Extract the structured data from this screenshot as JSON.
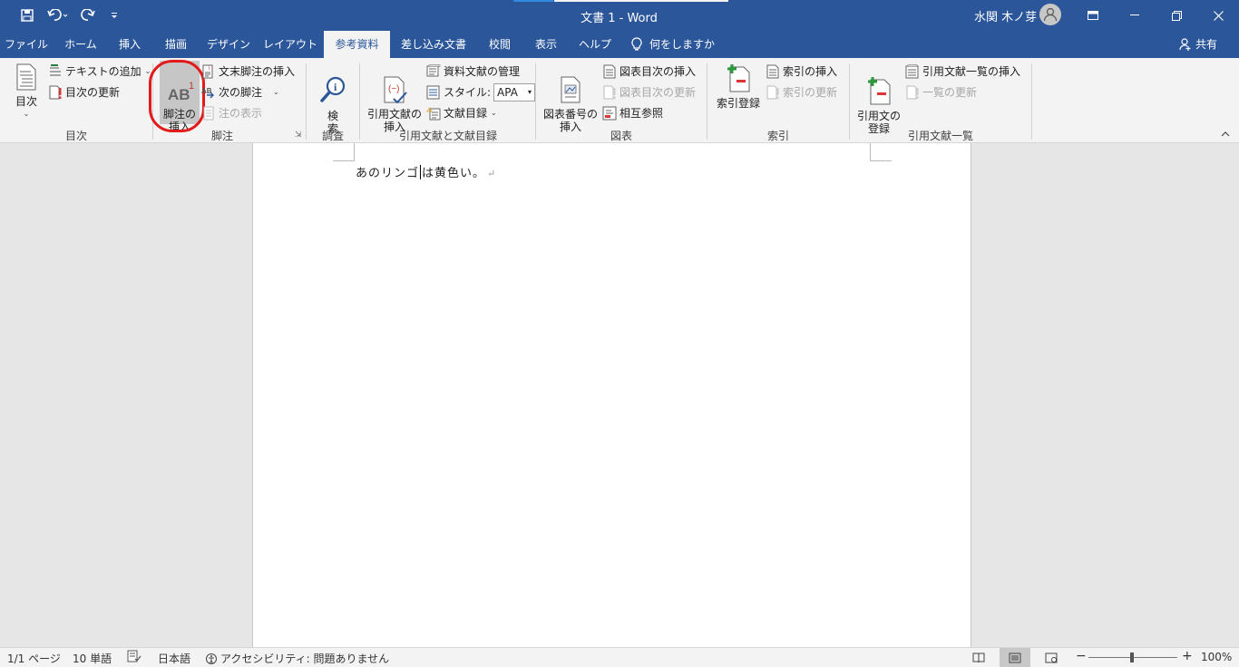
{
  "window": {
    "title": "文書 1  -  Word",
    "user_name": "水関 木ノ芽"
  },
  "quick_access": {
    "save_icon": "save-icon",
    "undo_icon": "undo-icon",
    "redo_icon": "redo-icon",
    "customize_icon": "customize-icon"
  },
  "tabs": [
    {
      "label": "ファイル"
    },
    {
      "label": "ホーム"
    },
    {
      "label": "挿入"
    },
    {
      "label": "描画"
    },
    {
      "label": "デザイン"
    },
    {
      "label": "レイアウト"
    },
    {
      "label": "参考資料"
    },
    {
      "label": "差し込み文書"
    },
    {
      "label": "校閲"
    },
    {
      "label": "表示"
    },
    {
      "label": "ヘルプ"
    },
    {
      "label": "何をしますか"
    }
  ],
  "share_label": "共有",
  "ribbon": {
    "toc": {
      "group": "目次",
      "toc_button": "目次",
      "add_text": "テキストの追加",
      "update_toc": "目次の更新"
    },
    "footnotes": {
      "group": "脚注",
      "insert_footnote": "脚注の\n挿入",
      "insert_endnote": "文末脚注の挿入",
      "next_footnote": "次の脚注",
      "show_notes": "注の表示"
    },
    "research": {
      "group": "調査",
      "search": "検\n索"
    },
    "citations": {
      "group": "引用文献と文献目録",
      "insert_citation": "引用文献の\n挿入",
      "manage_sources": "資料文献の管理",
      "style_label": "スタイル:",
      "style_value": "APA",
      "bibliography": "文献目録"
    },
    "captions": {
      "group": "図表",
      "insert_caption": "図表番号の\n挿入",
      "insert_table_of_figures": "図表目次の挿入",
      "update_table": "図表目次の更新",
      "cross_reference": "相互参照"
    },
    "index": {
      "group": "索引",
      "mark_entry": "索引登録",
      "insert_index": "索引の挿入",
      "update_index": "索引の更新"
    },
    "authorities": {
      "group": "引用文献一覧",
      "mark_citation": "引用文の\n登録",
      "insert_table": "引用文献一覧の挿入",
      "update_table": "一覧の更新"
    }
  },
  "document": {
    "text_before_cursor": "あのリンゴ",
    "text_after_cursor": "は黄色い。",
    "paragraph_mark": "↵"
  },
  "status": {
    "page": "1/1 ページ",
    "words": "10 単語",
    "language": "日本語",
    "accessibility": "アクセシビリティ: 問題ありません",
    "zoom": "100%"
  }
}
